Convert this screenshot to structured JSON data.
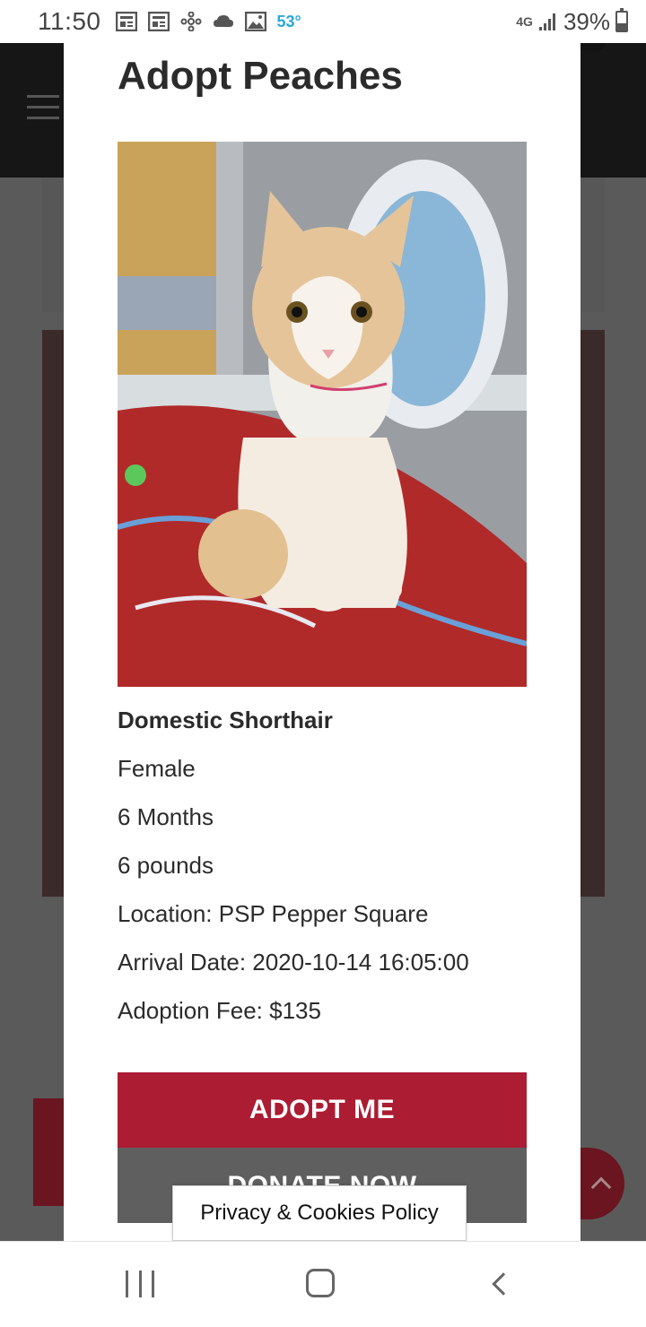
{
  "status_bar": {
    "time": "11:50",
    "temperature": "53°",
    "network": "4G",
    "battery_percent": "39%",
    "icons": [
      "news-icon",
      "news-icon",
      "pinwheel-icon",
      "cloud-icon",
      "image-icon",
      "signal-icon",
      "battery-icon"
    ]
  },
  "modal": {
    "title": "Adopt Peaches",
    "photo": {
      "subject": "cat-photo"
    },
    "details": {
      "breed": "Domestic Shorthair",
      "sex": "Female",
      "age": "6 Months",
      "weight": "6 pounds",
      "location": "Location: PSP Pepper Square",
      "arrival": "Arrival Date: 2020-10-14 16:05:00",
      "fee": "Adoption Fee: $135"
    },
    "buttons": {
      "adopt": "ADOPT ME",
      "donate": "DONATE NOW"
    }
  },
  "privacy_banner": {
    "label": "Privacy & Cookies Policy"
  },
  "nav_bar": {
    "items": [
      "recents-icon",
      "home-icon",
      "back-icon"
    ]
  },
  "colors": {
    "accent": "#ac1c32",
    "donate": "#5f5f5f",
    "temperature": "#2aa7d8"
  }
}
